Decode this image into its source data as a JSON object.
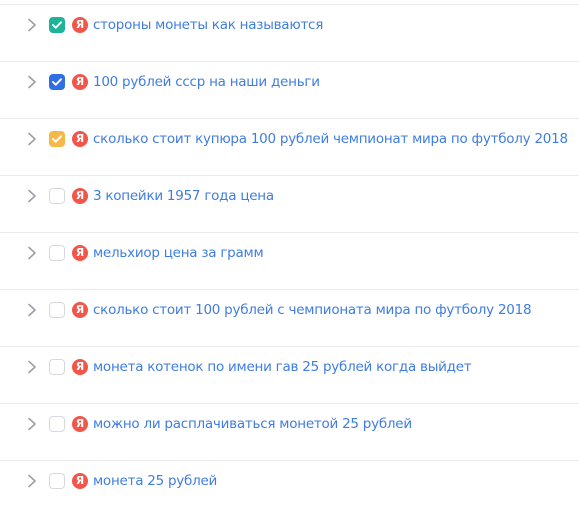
{
  "icons": {
    "expand": "chevron-right-icon",
    "checkmark": "checkmark-icon",
    "source": "yandex-logo-icon"
  },
  "colors": {
    "link": "#3f7de0",
    "yandex_badge": "#f2554a",
    "checkbox_teal": "#1fb39a",
    "checkbox_blue": "#2f6fe4",
    "checkbox_yellow": "#f5b84a",
    "divider": "#e8eaed",
    "chevron": "#9aa0a6"
  },
  "queries": [
    {
      "badge": "Я",
      "text": "стороны монеты как называются",
      "checked": true,
      "check_color": "#1fb39a"
    },
    {
      "badge": "Я",
      "text": "100 рублей ссср на наши деньги",
      "checked": true,
      "check_color": "#2f6fe4"
    },
    {
      "badge": "Я",
      "text": "сколько стоит купюра 100 рублей чемпионат мира по футболу 2018",
      "checked": true,
      "check_color": "#f5b84a"
    },
    {
      "badge": "Я",
      "text": "3 копейки 1957 года цена",
      "checked": false,
      "check_color": ""
    },
    {
      "badge": "Я",
      "text": "мельхиор цена за грамм",
      "checked": false,
      "check_color": ""
    },
    {
      "badge": "Я",
      "text": "сколько стоит 100 рублей с чемпионата мира по футболу 2018",
      "checked": false,
      "check_color": ""
    },
    {
      "badge": "Я",
      "text": "монета котенок по имени гав 25 рублей когда выйдет",
      "checked": false,
      "check_color": ""
    },
    {
      "badge": "Я",
      "text": "можно ли расплачиваться монетой 25 рублей",
      "checked": false,
      "check_color": ""
    },
    {
      "badge": "Я",
      "text": "монета 25 рублей",
      "checked": false,
      "check_color": ""
    }
  ]
}
